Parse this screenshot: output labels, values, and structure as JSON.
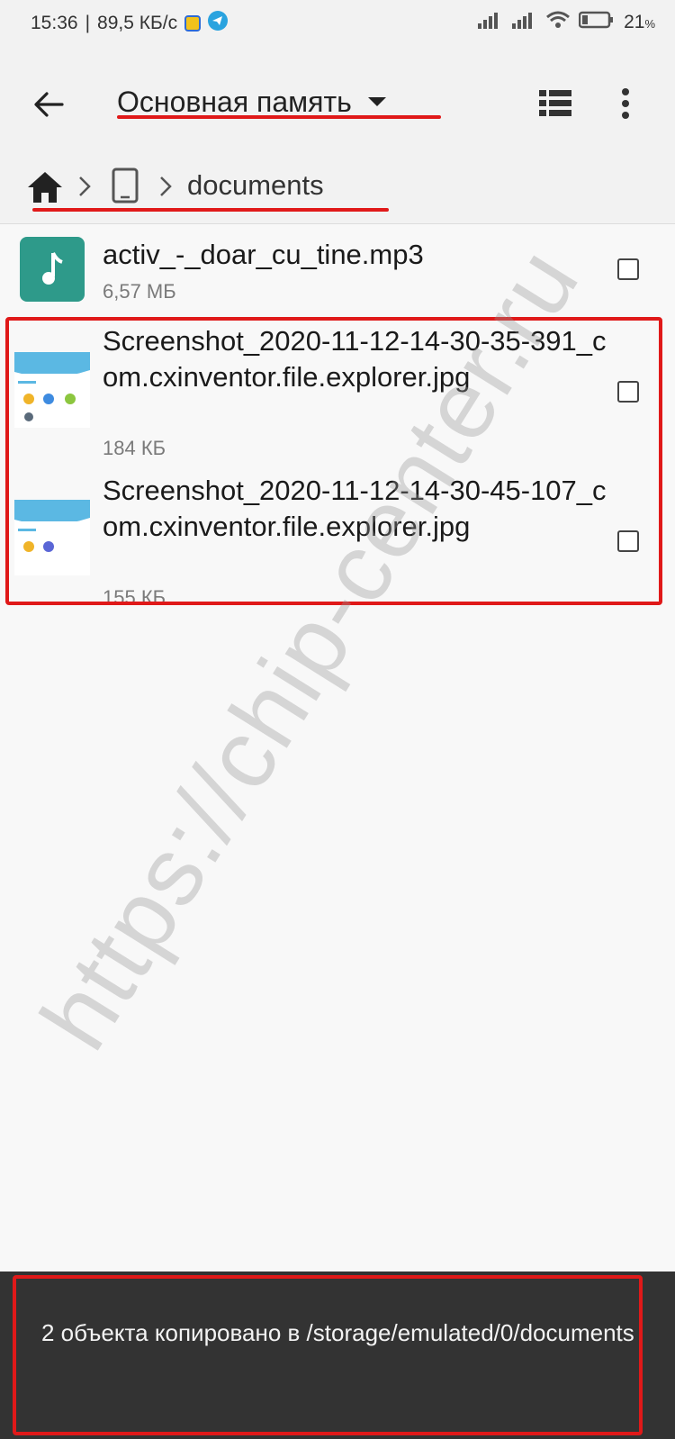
{
  "status_bar": {
    "time": "15:36",
    "speed": "89,5 КБ/с",
    "battery": "21",
    "battery_unit": "%",
    "icons": [
      "shield-notification-icon",
      "telegram-icon",
      "signal-icon",
      "signal-icon",
      "wifi-icon",
      "battery-icon"
    ]
  },
  "toolbar": {
    "title": "Основная память",
    "back_icon": "arrow-back-icon",
    "view_icon": "list-view-icon",
    "menu_icon": "more-vertical-icon"
  },
  "breadcrumb": {
    "home_icon": "home-icon",
    "device_icon": "phone-icon",
    "folder": "documents"
  },
  "files": [
    {
      "name": "activ_-_doar_cu_tine.mp3",
      "size": "6,57 МБ",
      "type": "audio",
      "checked": false
    },
    {
      "name": "Screenshot_2020-11-12-14-30-35-391_com.cxinventor.file.explorer.jpg",
      "size": "184 КБ",
      "type": "image",
      "checked": false
    },
    {
      "name": "Screenshot_2020-11-12-14-30-45-107_com.cxinventor.file.explorer.jpg",
      "size": "155 КБ",
      "type": "image",
      "checked": false
    }
  ],
  "watermark": "https://chip-center.ru",
  "snackbar": {
    "message": "2 объекта копировано в /storage/emulated/0/documents"
  },
  "colors": {
    "highlight": "#e01919",
    "audio_thumb": "#2e9a8a",
    "snackbar_bg": "#333333"
  }
}
